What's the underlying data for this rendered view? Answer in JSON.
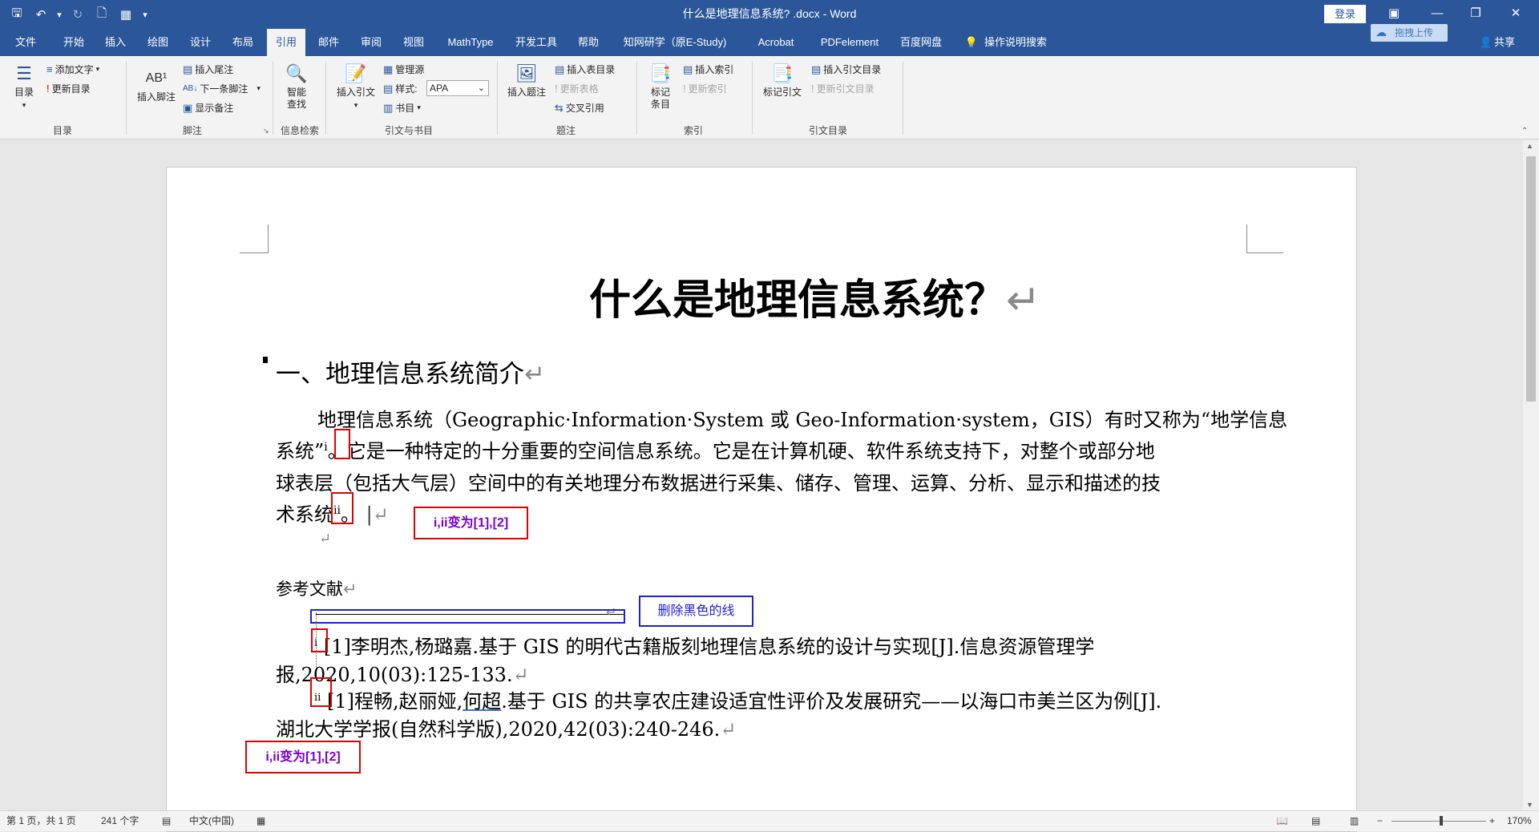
{
  "window": {
    "title": "什么是地理信息系统? .docx  -  Word",
    "login": "登录"
  },
  "qat": {
    "save": "🖫",
    "undo": "↶",
    "undo_arrow": "▾",
    "redo": "↻",
    "new_doc": "🗋",
    "touch": "▦",
    "more": "▾"
  },
  "tabs": [
    "文件",
    "开始",
    "插入",
    "绘图",
    "设计",
    "布局",
    "引用",
    "邮件",
    "审阅",
    "视图",
    "MathType",
    "开发工具",
    "帮助",
    "知网研学（原E-Study)",
    "Acrobat",
    "PDFelement",
    "百度网盘",
    "操作说明搜索"
  ],
  "share": "共享",
  "baidu_upload": "拖拽上传",
  "ribbon": {
    "toc": {
      "big": "目录",
      "add_text": "添加文字",
      "update": "更新目录",
      "group": "目录"
    },
    "footnote": {
      "insert": "插入脚注",
      "endnote": "插入尾注",
      "next": "下一条脚注",
      "show": "显示备注",
      "group": "脚注"
    },
    "research": {
      "smart": "智能\n查找",
      "group": "信息检索"
    },
    "cite": {
      "insert": "插入引文",
      "manage": "管理源",
      "style_label": "样式:",
      "style_value": "APA",
      "biblio": "书目",
      "group": "引文与书目"
    },
    "caption": {
      "insert": "插入题注",
      "tof": "插入表目录",
      "update_table": "更新表格",
      "cross": "交叉引用",
      "group": "题注"
    },
    "index": {
      "mark": "标记\n条目",
      "insert": "插入索引",
      "update": "更新索引",
      "group": "索引"
    },
    "toa": {
      "mark": "标记引文",
      "insert": "插入引文目录",
      "update": "更新引文目录",
      "group": "引文目录"
    }
  },
  "doc": {
    "title": "什么是地理信息系统？",
    "heading": "一、地理信息系统简介",
    "p1_l1": "地理信息系统（Geographic·Information·System 或 Geo-Information·system，GIS）有时又称为“地学信息",
    "p1_l2a": "系统”",
    "fn1": "i",
    "p1_l2b": "。它是一种特定的十分重要的空间信息系统。它是在计算机硬、软件系统支持下，对整个或部分地",
    "p1_l3": "球表层（包括大气层）空间中的有关地理分布数据进行采集、储存、管理、运算、分析、显示和描述的技",
    "p1_l4a": "术系统",
    "fn2": "ii",
    "p1_l4b": "。",
    "ref_heading": "参考文献",
    "ref1_l1": "[1]李明杰,杨璐嘉.基于 GIS 的明代古籍版刻地理信息系统的设计与实现[J].信息资源管理学",
    "ref1_l2": "报,2020,10(03):125-133.",
    "ref2_l1a": "[1]程畅,赵丽娅,",
    "ref2_name": "何超",
    "ref2_l1b": ".基于 GIS 的共享农庄建设适宜性评价及发展研究——以海口市美兰区为例[J].",
    "ref2_l2": "湖北大学学报(自然科学版),2020,42(03):240-246.",
    "ref_mark1": "i",
    "ref_mark2": "ii",
    "return": "↵"
  },
  "annotations": {
    "a1": "i,ii变为[1],[2]",
    "a2": "删除黑色的线",
    "a3": "i,ii变为[1],[2]",
    "red": "#e00000",
    "blue": "#1f1fd6",
    "annot_text": "#7a00cc"
  },
  "status": {
    "page": "第 1 页，共 1 页",
    "words": "241 个字",
    "lang": "中文(中国)",
    "zoom": "170%"
  },
  "colors": {
    "word_blue": "#2b579a",
    "ribbon_bg": "#f3f3f3"
  }
}
